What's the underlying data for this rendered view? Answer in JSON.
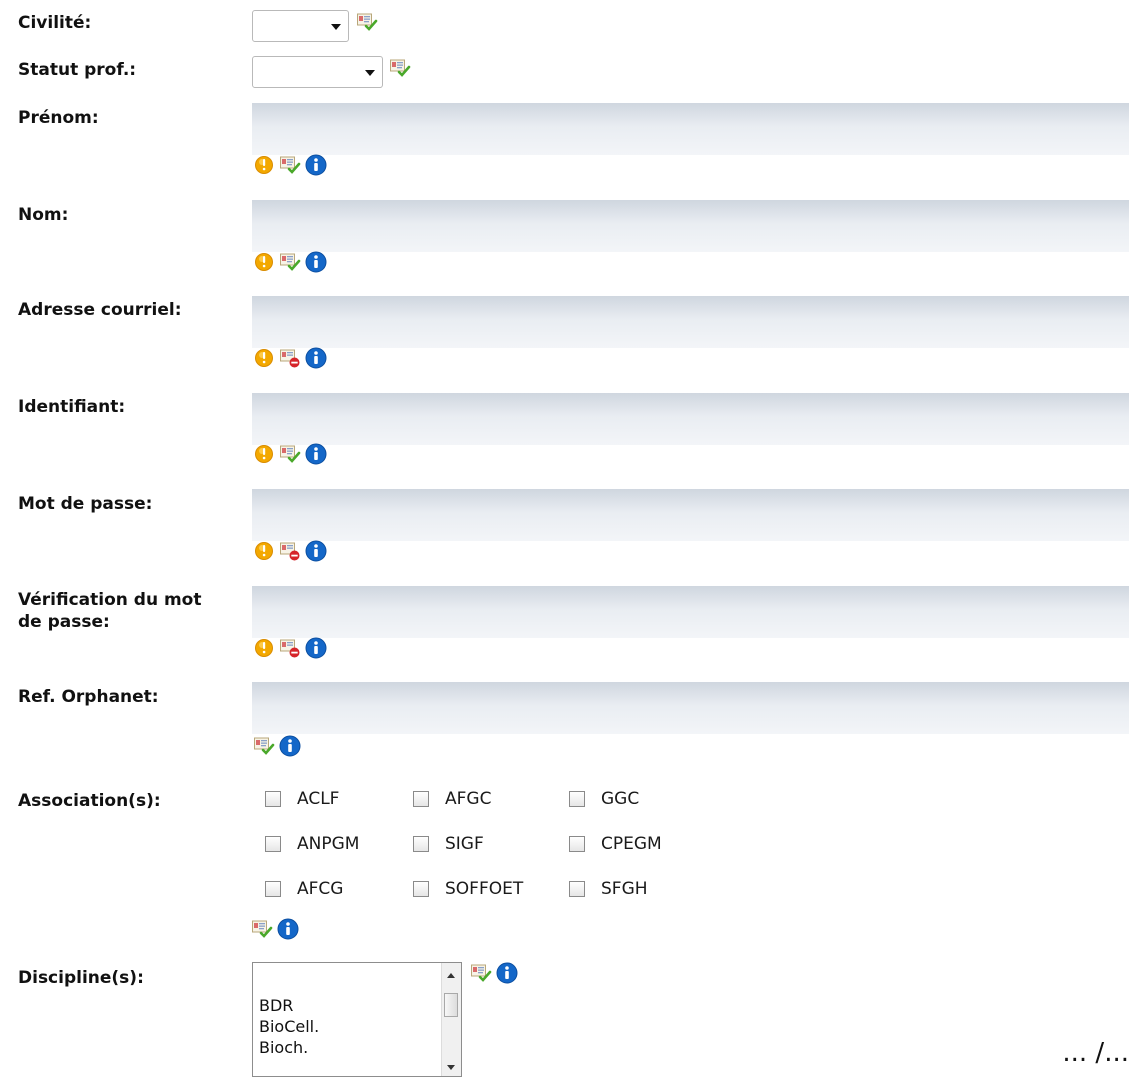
{
  "fields": {
    "civilite": {
      "label": "Civilité:",
      "value": ""
    },
    "statut": {
      "label": "Statut prof.:",
      "value": ""
    },
    "prenom": {
      "label": "Prénom:",
      "value": ""
    },
    "nom": {
      "label": "Nom:",
      "value": ""
    },
    "adresse": {
      "label": "Adresse courriel:",
      "value": ""
    },
    "identifiant": {
      "label": "Identifiant:",
      "value": ""
    },
    "motdepasse": {
      "label": "Mot de passe:",
      "value": ""
    },
    "verification": {
      "label_line1": "Vérification du mot",
      "label_line2": "de passe:",
      "value": ""
    },
    "reforphanet": {
      "label": "Ref. Orphanet:",
      "value": ""
    },
    "associations": {
      "label": "Association(s):",
      "options": [
        "ACLF",
        "AFGC",
        "GGC",
        "ANPGM",
        "SIGF",
        "CPEGM",
        "AFCG",
        "SOFFOET",
        "SFGH"
      ]
    },
    "disciplines": {
      "label": "Discipline(s):",
      "options": [
        "BDR",
        "BioCell.",
        "Bioch."
      ]
    }
  },
  "continuation": "... /...",
  "icon_names": [
    "required-icon",
    "public-visibility-icon",
    "private-visibility-icon",
    "info-icon"
  ],
  "colors": {
    "field_bg_top": "#cfd6df",
    "field_bg_bottom": "#f3f5f8",
    "info_blue": "#1467c8",
    "required_orange": "#f2a400"
  }
}
